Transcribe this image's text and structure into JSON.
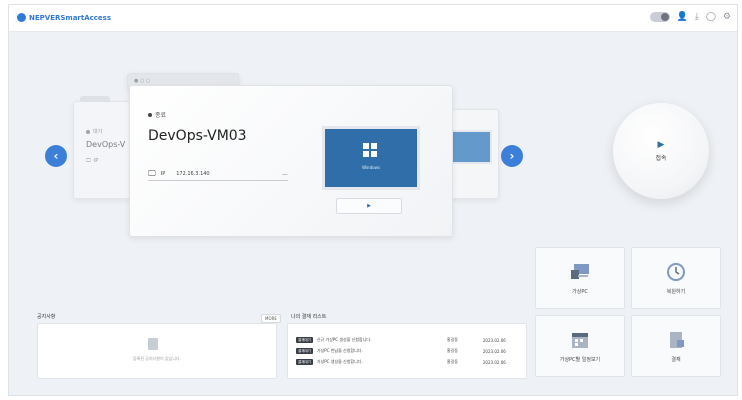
{
  "app": {
    "logo_text": "NEPVERSmartAccess",
    "brand_color": "#2f7ad6",
    "topbar_icons": [
      "toggle-icon",
      "user-icon",
      "download-icon",
      "bell-icon",
      "settings-icon"
    ]
  },
  "carousel": {
    "prev_icon": "‹",
    "next_icon": "›",
    "back_card": {
      "status": "대기",
      "name": "DevOps-V",
      "ip_label": "IP"
    },
    "main_card": {
      "status": "종료",
      "name": "DevOps-VM03",
      "ip_label": "IP",
      "ip_value": "172.16.3.140",
      "os_label": "Windows",
      "play_label": "▶"
    }
  },
  "connect": {
    "icon": "▶",
    "label": "접속"
  },
  "tiles": [
    {
      "label": "가상PC",
      "icon": "computer-icon"
    },
    {
      "label": "복원하기",
      "icon": "restore-icon"
    },
    {
      "label": "가상PC별 일정보기",
      "icon": "calendar-icon"
    },
    {
      "label": "결재",
      "icon": "document-icon"
    }
  ],
  "notice": {
    "title": "공지사항",
    "more_label": "MORE",
    "empty_text": "등록된 공지사항이 없습니다."
  },
  "tasks": {
    "title": "나의 결재 리스트",
    "rows": [
      {
        "badge": "결재대기",
        "text": "신규 가상PC 생성을 신청합니다.",
        "user": "홍길동",
        "date": "2023.02.06"
      },
      {
        "badge": "결재대기",
        "text": "가상PC 반납을 신청합니다.",
        "user": "홍길동",
        "date": "2023.02.06"
      },
      {
        "badge": "결재대기",
        "text": "가상PC 생성을 신청합니다.",
        "user": "홍길동",
        "date": "2023.02.06"
      }
    ]
  }
}
